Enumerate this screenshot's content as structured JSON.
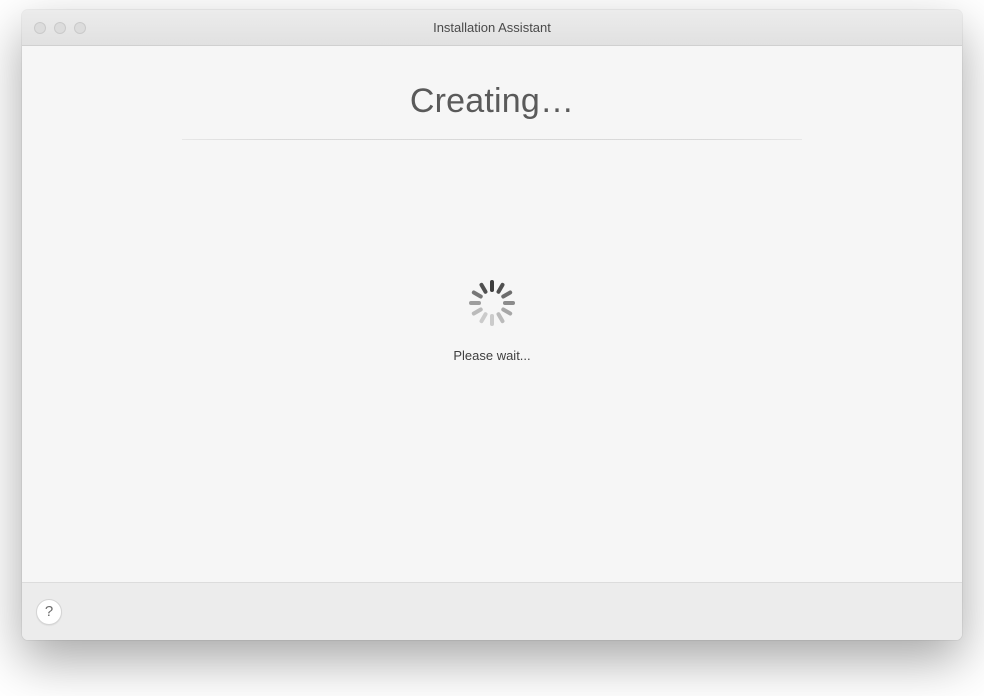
{
  "window": {
    "title": "Installation Assistant"
  },
  "main": {
    "heading": "Creating…",
    "status": "Please wait..."
  },
  "footer": {
    "help_label": "?"
  }
}
